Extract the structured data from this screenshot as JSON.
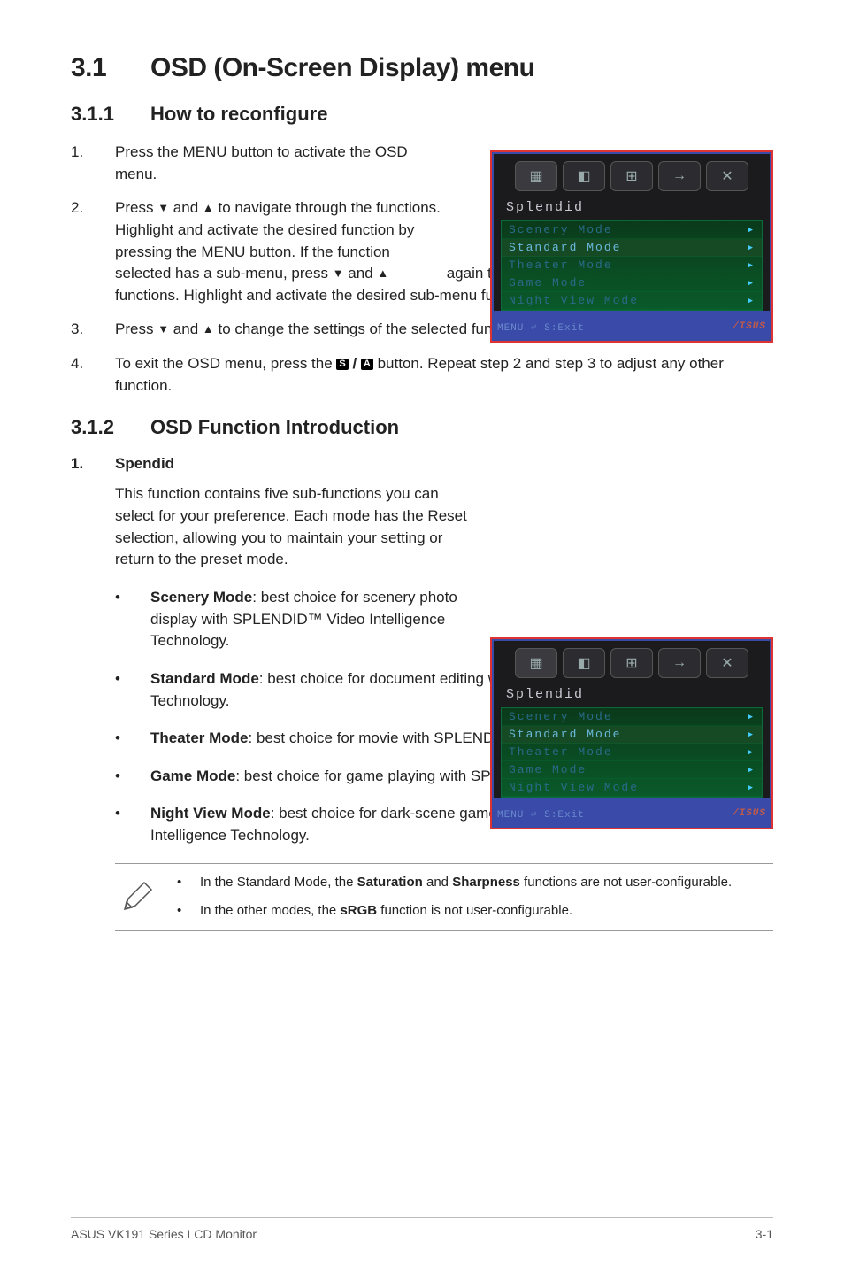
{
  "title": {
    "num": "3.1",
    "text": "OSD (On-Screen Display) menu"
  },
  "section_311": {
    "num": "3.1.1",
    "text": "How to reconfigure"
  },
  "steps_311": {
    "s1_n": "1.",
    "s1_t": "Press the MENU button to activate the OSD menu.",
    "s2_n": "2.",
    "s2_a": "Press ",
    "s2_b": " and ",
    "s2_c": " to navigate through the functions. Highlight and activate the desired function by pressing the MENU button. If the function selected has a sub-menu, press ",
    "s2_d": " and ",
    "s2_e": " again to navigate through the sub-menu functions. Highlight and activate the desired sub-menu function by pressing the MENU button.",
    "s3_n": "3.",
    "s3_a": "Press ",
    "s3_b": " and ",
    "s3_c": " to change the settings of the selected function.",
    "s4_n": "4.",
    "s4_a": "To exit the OSD menu, press the ",
    "s4_s": "S",
    "s4_slash": " / ",
    "s4_aicon": "A",
    "s4_b": " button. Repeat step 2 and step 3 to adjust any other function."
  },
  "section_312": {
    "num": "3.1.2",
    "text": "OSD Function Introduction"
  },
  "spendid": {
    "n": "1.",
    "label": "Spendid"
  },
  "spendid_intro": "This function contains five sub-functions you can select for your preference. Each mode has the Reset selection, allowing you to maintain your setting or return to the preset mode.",
  "modes": {
    "scenery_name": "Scenery Mode",
    "scenery_text": ": best choice for scenery photo display with SPLENDID™ Video Intelligence Technology.",
    "standard_name": "Standard Mode",
    "standard_text": ": best choice for document editing with SPLENDID™ Video Intelligence Technology.",
    "theater_name": "Theater Mode",
    "theater_text": ": best choice for movie with SPLENDID™ Video Intelligence Technology.",
    "game_name": "Game Mode",
    "game_text": ": best choice for game playing with SPLENDID™ Video Intelligence Technology.",
    "night_name": "Night View Mode",
    "night_text": ": best choice for dark-scene game or movie with SPLENDID™ Video Intelligence Technology."
  },
  "notes": {
    "n1_a": "In the Standard Mode, the ",
    "n1_b": "Saturation",
    "n1_c": " and ",
    "n1_d": "Sharpness",
    "n1_e": " functions are not user-configurable.",
    "n2_a": "In the other modes, the ",
    "n2_b": "sRGB",
    "n2_c": " function is not user-configurable."
  },
  "footer": {
    "left": "ASUS VK191 Series LCD Monitor",
    "right": "3-1"
  },
  "osd": {
    "label": "Splendid",
    "items": [
      "Scenery Mode",
      "Standard Mode",
      "Theater Mode",
      "Game Mode",
      "Night View Mode"
    ],
    "foot_left": "MENU ⏎  S:Exit",
    "brand": "/ISUS"
  },
  "arrow_down": "▼",
  "arrow_up": "▲",
  "bullet": "•"
}
